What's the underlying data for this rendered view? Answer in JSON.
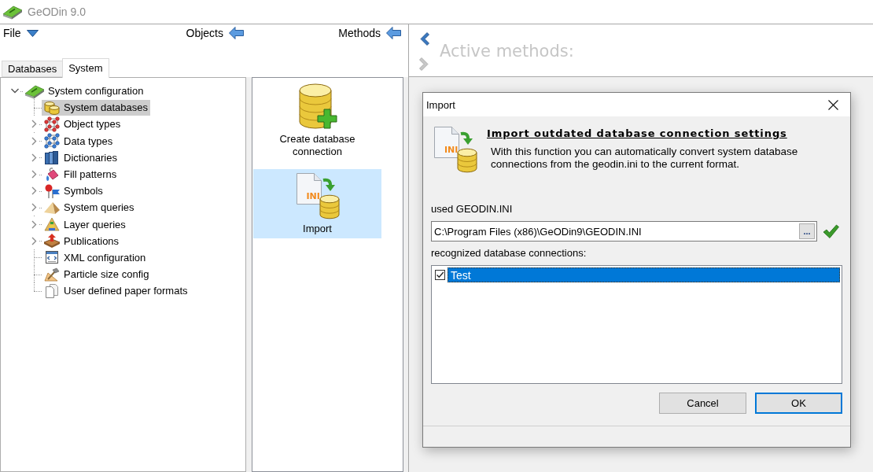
{
  "window": {
    "title": "GeODin 9.0"
  },
  "toolbar": {
    "file_menu": "File",
    "objects_button": "Objects",
    "methods_button": "Methods"
  },
  "tabs": [
    {
      "label": "Databases",
      "selected": false
    },
    {
      "label": "System",
      "selected": true
    }
  ],
  "tree": [
    {
      "label": "System configuration",
      "expandable": true,
      "expanded": true,
      "selected": false,
      "children": [
        {
          "label": "System databases",
          "expandable": false,
          "selected": true
        },
        {
          "label": "Object types",
          "expandable": true,
          "expanded": false,
          "selected": false
        },
        {
          "label": "Data types",
          "expandable": true,
          "expanded": false,
          "selected": false
        },
        {
          "label": "Dictionaries",
          "expandable": true,
          "expanded": false,
          "selected": false
        },
        {
          "label": "Fill patterns",
          "expandable": true,
          "expanded": false,
          "selected": false
        },
        {
          "label": "Symbols",
          "expandable": true,
          "expanded": false,
          "selected": false
        },
        {
          "label": "System queries",
          "expandable": true,
          "expanded": false,
          "selected": false
        },
        {
          "label": "Layer queries",
          "expandable": true,
          "expanded": false,
          "selected": false
        },
        {
          "label": "Publications",
          "expandable": true,
          "expanded": false,
          "selected": false
        },
        {
          "label": "XML configuration",
          "expandable": false,
          "selected": false
        },
        {
          "label": "Particle size config",
          "expandable": false,
          "selected": false
        },
        {
          "label": "User defined paper formats",
          "expandable": false,
          "selected": false
        }
      ]
    }
  ],
  "actions": [
    {
      "label": "Create database connection",
      "selected": false
    },
    {
      "label": "Import",
      "icon_label": "INI",
      "selected": true
    }
  ],
  "methods_panel": {
    "title": "Active methods:",
    "back_enabled": true,
    "forward_enabled": false
  },
  "dialog": {
    "title": "Import",
    "icon_label": "INI",
    "heading": "Import outdated database connection settings",
    "description": "With this function you can automatically convert system database connections from the geodin.ini to the current format.",
    "path_label": "used GEODIN.INI",
    "path_value": "C:\\Program Files (x86)\\GeODin9\\GEODIN.INI",
    "browse_button": "...",
    "path_valid": true,
    "connections_label": "recognized database connections:",
    "connections": [
      {
        "label": "Test",
        "checked": true,
        "selected": true
      }
    ],
    "buttons": [
      {
        "label": "Cancel",
        "default": false
      },
      {
        "label": "OK",
        "default": true
      }
    ]
  }
}
